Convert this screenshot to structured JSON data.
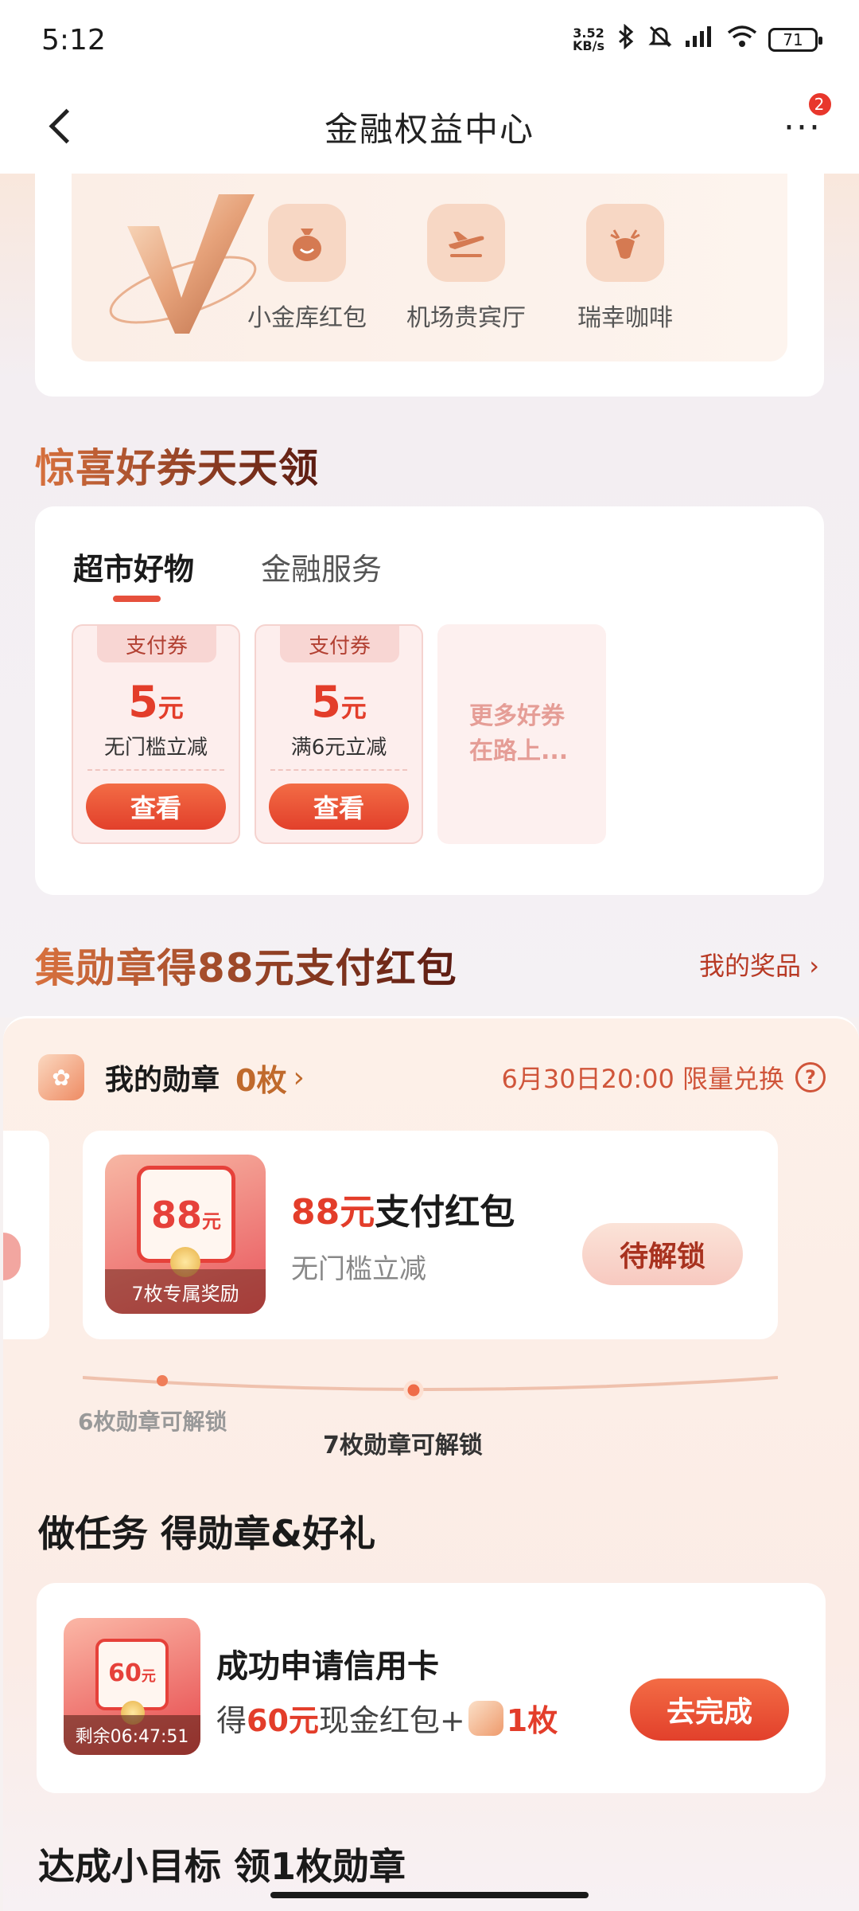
{
  "status_bar": {
    "time": "5:12",
    "net_speed_value": "3.52",
    "net_speed_unit": "KB/s",
    "battery": "71"
  },
  "header": {
    "title": "金融权益中心",
    "badge_count": "2"
  },
  "benefits": {
    "items": [
      {
        "label": "小金库红包",
        "icon": "money-bag-icon"
      },
      {
        "label": "机场贵宾厅",
        "icon": "airplane-icon"
      },
      {
        "label": "瑞幸咖啡",
        "icon": "deer-icon"
      }
    ]
  },
  "coupons_section": {
    "title": "惊喜好券天天领",
    "tabs": [
      "超市好物",
      "金融服务"
    ],
    "coupons": [
      {
        "tag": "支付券",
        "amount": "5",
        "unit": "元",
        "desc": "无门槛立减",
        "button": "查看"
      },
      {
        "tag": "支付券",
        "amount": "5",
        "unit": "元",
        "desc": "满6元立减",
        "button": "查看"
      }
    ],
    "more_line1": "更多好券",
    "more_line2": "在路上..."
  },
  "medal_section": {
    "title": "集勋章得88元支付红包",
    "my_prize": "我的奖品",
    "my_medal_label": "我的勋章",
    "my_medal_count": "0枚",
    "deadline": "6月30日20:00 限量兑换",
    "prize": {
      "image_amount": "88",
      "image_unit": "元",
      "ribbon": "7枚专属奖励",
      "title_highlight": "88元",
      "title_rest": "支付红包",
      "subtitle": "无门槛立减",
      "button": "待解锁"
    },
    "progress": {
      "left_label": "6枚勋章可解锁",
      "active_label": "7枚勋章可解锁"
    }
  },
  "tasks_section": {
    "title": "做任务 得勋章&好礼",
    "task": {
      "image_amount": "60",
      "image_unit": "元",
      "timer": "剩余06:47:51",
      "name": "成功申请信用卡",
      "reward_prefix": "得",
      "reward_amount": "60元",
      "reward_middle": "现金红包+",
      "reward_medal": "1枚",
      "button": "去完成"
    }
  },
  "goal_section": {
    "title": "达成小目标 领1枚勋章"
  },
  "colors": {
    "accent_red": "#e33d2a",
    "button_orange": "#f36c45",
    "title_brown": "#6b2414"
  }
}
